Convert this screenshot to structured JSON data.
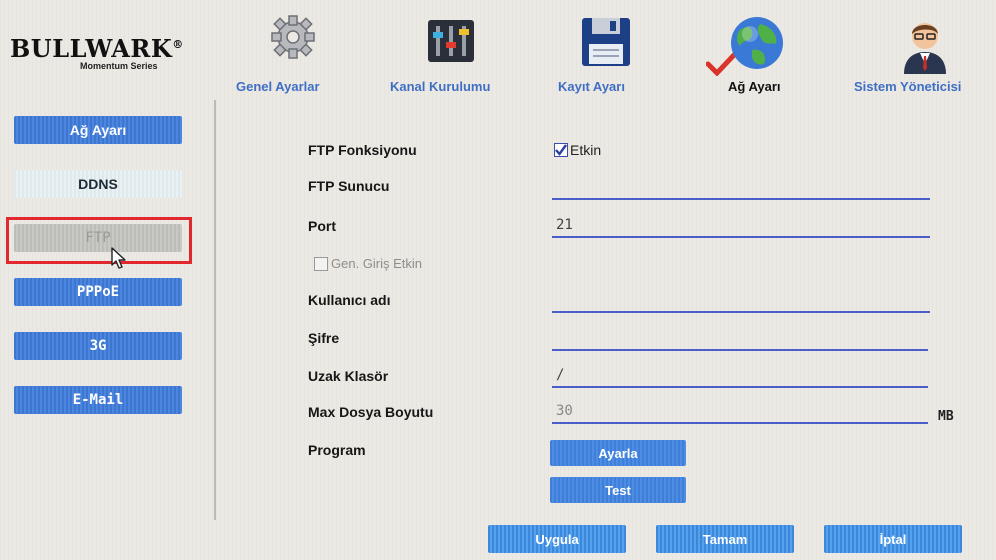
{
  "brand": {
    "name": "BULLWARK",
    "registered": "®",
    "tagline": "Momentum Series"
  },
  "nav": {
    "items": [
      {
        "label": "Genel Ayarlar",
        "icon": "gear-icon"
      },
      {
        "label": "Kanal Kurulumu",
        "icon": "equalizer-icon"
      },
      {
        "label": "Kayıt Ayarı",
        "icon": "floppy-disk-icon"
      },
      {
        "label": "Ağ Ayarı",
        "icon": "globe-icon",
        "active": true
      },
      {
        "label": "Sistem Yöneticisi",
        "icon": "user-icon"
      }
    ]
  },
  "sidebar": {
    "items": [
      {
        "label": "Ağ Ayarı"
      },
      {
        "label": "DDNS"
      },
      {
        "label": "FTP"
      },
      {
        "label": "PPPoE"
      },
      {
        "label": "3G"
      },
      {
        "label": "E-Mail"
      }
    ]
  },
  "form": {
    "ftp_function": {
      "label": "FTP Fonksiyonu",
      "checkbox_label": "Etkin",
      "checked": true
    },
    "ftp_server": {
      "label": "FTP Sunucu",
      "value": ""
    },
    "port": {
      "label": "Port",
      "value": "21"
    },
    "anon_login": {
      "label": "Gen. Giriş Etkin",
      "checked": false
    },
    "username": {
      "label": "Kullanıcı adı",
      "value": ""
    },
    "password": {
      "label": "Şifre",
      "value": ""
    },
    "remote_folder": {
      "label": "Uzak Klasör",
      "value": "/"
    },
    "max_file_size": {
      "label": "Max Dosya Boyutu",
      "value": "30",
      "unit": "MB"
    },
    "program": {
      "label": "Program",
      "set_button": "Ayarla",
      "test_button": "Test"
    }
  },
  "footer": {
    "apply": "Uygula",
    "ok": "Tamam",
    "cancel": "İptal"
  },
  "colors": {
    "accent": "#3d76d1",
    "highlight": "#e0282e",
    "active_nav_check": "#d9342b"
  }
}
